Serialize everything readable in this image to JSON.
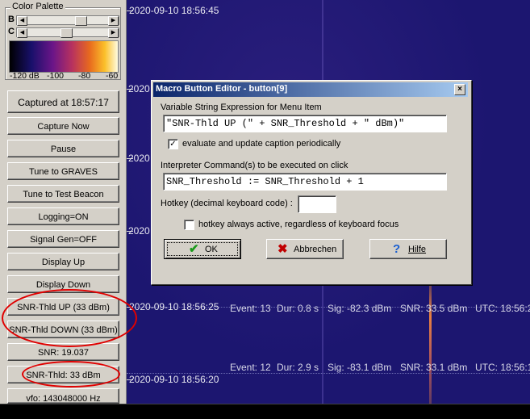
{
  "palette": {
    "title": "Color Palette",
    "b_label": "B",
    "c_label": "C",
    "b_thumb_level": 0.6,
    "c_thumb_level": 0.45,
    "scale_labels": [
      "-120 dB",
      "-100",
      "-80",
      "-60"
    ]
  },
  "left_buttons": [
    "Captured at 18:57:17",
    "Capture Now",
    "Pause",
    "Tune to GRAVES",
    "Tune to Test Beacon",
    "Logging=ON",
    "Signal Gen=OFF",
    "Display Up",
    "Display Down",
    "SNR-Thld UP (33 dBm)",
    "SNR-Thld DOWN (33 dBm)",
    "SNR: 19.037",
    "SNR-Thld: 33 dBm",
    "vfo: 143048000 Hz"
  ],
  "waterfall": {
    "timestamps": [
      "2020-09-10 18:56:45",
      "2020-09-10 18:56:25",
      "2020-09-10 18:56:20"
    ],
    "partial_labels": [
      "2020",
      "2020",
      "2020"
    ],
    "events": [
      {
        "event": "Event: 13",
        "dur": "Dur: 0.8 s",
        "sig": "Sig: -82.3 dBm",
        "snr": "SNR: 33.5 dBm",
        "utc": "UTC: 18:56:2"
      },
      {
        "event": "Event: 12",
        "dur": "Dur: 2.9 s",
        "sig": "Sig: -83.1 dBm",
        "snr": "SNR: 33.1 dBm",
        "utc": "UTC: 18:56:1"
      }
    ]
  },
  "dialog": {
    "title": "Macro Button Editor - button[9]",
    "close_glyph": "×",
    "var_label": "Variable String Expression for Menu Item",
    "var_value": "\"SNR-Thld UP (\" + SNR_Threshold + \" dBm)\"",
    "evaluate_label": "evaluate and update caption periodically",
    "evaluate_checked": true,
    "cmd_label": "Interpreter Command(s) to be executed on click",
    "cmd_value": "SNR_Threshold := SNR_Threshold + 1",
    "hotkey_label": "Hotkey (decimal keyboard code) :",
    "hotkey_value": "",
    "hotkey_always_label": "hotkey always active, regardless of keyboard focus",
    "hotkey_always_checked": false,
    "ok_label": "OK",
    "cancel_label": "Abbrechen",
    "help_label": "Hilfe",
    "check_glyph": "✓"
  },
  "colors": {
    "annotation": "#e00000",
    "dialog_title_start": "#0a246a",
    "waterfall_bg": "#1c1670",
    "ok_icon": "#1a9a1a",
    "cancel_icon": "#c00000",
    "help_icon": "#1a5fd0"
  }
}
